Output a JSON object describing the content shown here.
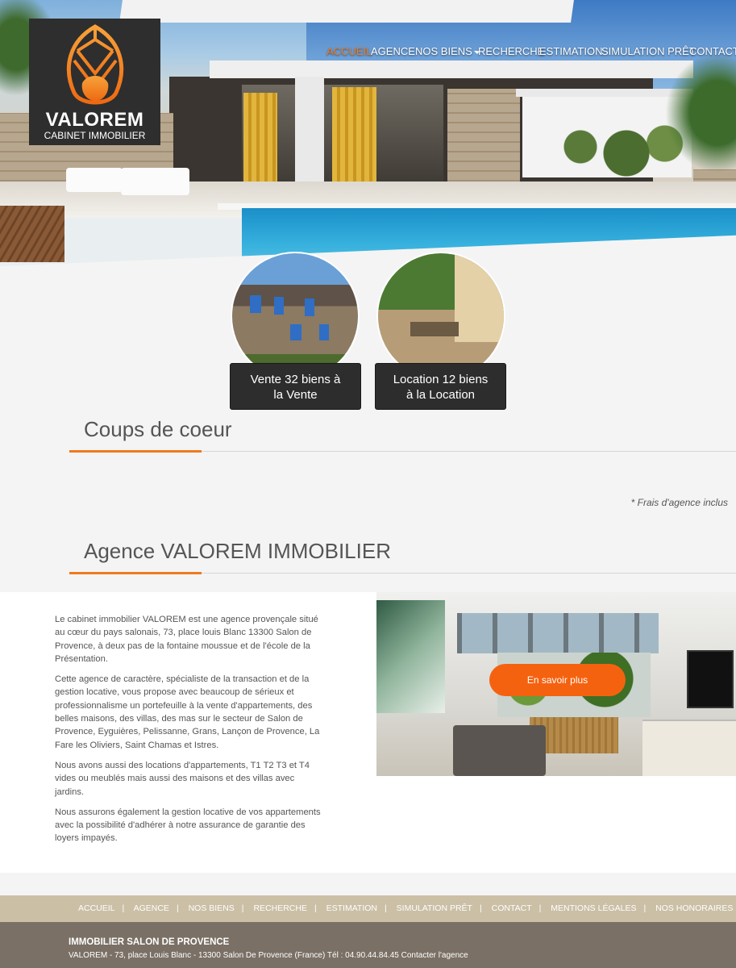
{
  "brand": {
    "name": "VALOREM",
    "tagline": "CABINET IMMOBILIER",
    "accent_color": "#f07a1e"
  },
  "nav": {
    "items": [
      {
        "label": "ACCUEIL",
        "active": true
      },
      {
        "label": "AGENCE"
      },
      {
        "label": "NOS BIENS",
        "dropdown": true
      },
      {
        "label": "RECHERCHE"
      },
      {
        "label": "ESTIMATION"
      },
      {
        "label": "SIMULATION PRÊT"
      },
      {
        "label": "CONTACT"
      }
    ]
  },
  "categories": [
    {
      "line1": "Vente 32 biens à",
      "line2": "la Vente",
      "image": "stone-cottage-photo"
    },
    {
      "line1": "Location 12 biens",
      "line2": "à la Location",
      "image": "garden-terrace-photo"
    }
  ],
  "favorites": {
    "title": "Coups de coeur",
    "note": "* Frais d'agence inclus"
  },
  "agency": {
    "title": "Agence VALOREM IMMOBILIER",
    "paragraphs": [
      "Le cabinet immobilier VALOREM est une agence provençale situé au cœur du pays salonais, 73, place louis Blanc 13300 Salon de Provence, à deux pas de la fontaine moussue et de l'école de la Présentation.",
      "Cette agence de caractère, spécialiste de la transaction et de la gestion locative, vous propose avec beaucoup de sérieux et professionnalisme un portefeuille à la vente d'appartements, des belles maisons, des villas, des mas sur le secteur de Salon de Provence, Eyguières, Pelissanne, Grans, Lançon de Provence, La Fare les Oliviers, Saint Chamas et Istres.",
      "Nous avons aussi des locations d'appartements, T1 T2 T3 et T4 vides ou meublés mais aussi des maisons et des villas avec jardins.",
      "Nous assurons également la gestion locative de vos appartements avec la possibilité d'adhérer à notre assurance de garantie des loyers impayés."
    ],
    "cta": "En savoir plus"
  },
  "footer": {
    "links": [
      "ACCUEIL",
      "AGENCE",
      "NOS BIENS",
      "RECHERCHE",
      "ESTIMATION",
      "SIMULATION PRÊT",
      "CONTACT",
      "MENTIONS LÉGALES",
      "NOS HONORAIRES"
    ],
    "title": "IMMOBILIER SALON DE PROVENCE",
    "address": "VALOREM - 73, place Louis Blanc - 13300 Salon De Provence (France) Tél : 04.90.44.84.45 Contacter l'agence"
  }
}
